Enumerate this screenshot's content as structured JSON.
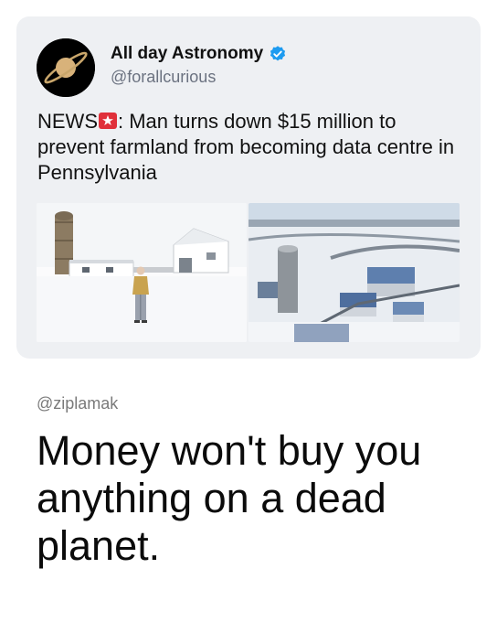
{
  "tweet": {
    "author_name": "All day Astronomy",
    "author_handle": "@forallcurious",
    "verified": true,
    "headline_prefix": "NEWS",
    "headline_emoji": "police-siren-icon",
    "headline_text": ": Man turns down $15 million to prevent farmland from becoming data centre in Pennsylvania",
    "media": [
      {
        "icon": "farm-photo-man-in-snow"
      },
      {
        "icon": "aerial-farm-photo-snow"
      }
    ]
  },
  "reply": {
    "handle": "@ziplamak",
    "text": "Money won't buy you anything on a dead planet."
  },
  "colors": {
    "card_bg": "#eef0f3",
    "verified_blue": "#1d9bf0",
    "siren_red": "#e0303a"
  }
}
